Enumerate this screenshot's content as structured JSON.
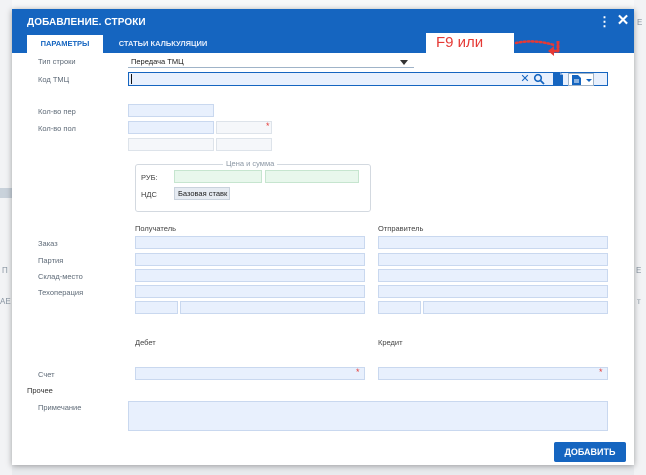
{
  "background": {
    "fragments": [
      "Е",
      "П",
      "Е",
      "АЕ",
      "т"
    ]
  },
  "dialog": {
    "title": "ДОБАВЛЕНИЕ. СТРОКИ",
    "tabs": [
      {
        "label": "ПАРАМЕТРЫ",
        "active": true
      },
      {
        "label": "СТАТЬИ КАЛЬКУЛЯЦИИ",
        "active": false
      }
    ],
    "annotation": "F9 или",
    "form": {
      "row_type_label": "Тип строки",
      "row_type_value": "Передача ТМЦ",
      "code_label": "Код ТМЦ",
      "code_value": "",
      "qty_per_label": "Кол-во пер",
      "qty_pol_label": "Кол-во пол",
      "price_group_title": "Цена и сумма",
      "currency_label": "РУБ:",
      "vat_label": "НДС",
      "vat_value": "Базовая ставк",
      "recipient_label": "Получатель",
      "sender_label": "Отправитель",
      "order_label": "Заказ",
      "batch_label": "Партия",
      "warehouse_label": "Склад-место",
      "techop_label": "Техоперация",
      "debit_label": "Дебет",
      "credit_label": "Кредит",
      "account_label": "Счет",
      "other_label": "Прочее",
      "note_label": "Примечание"
    },
    "add_button": "ДОБАВИТЬ"
  },
  "colors": {
    "header": "#1565c0",
    "annotation": "#e53935",
    "field": "#e8f0fd"
  }
}
